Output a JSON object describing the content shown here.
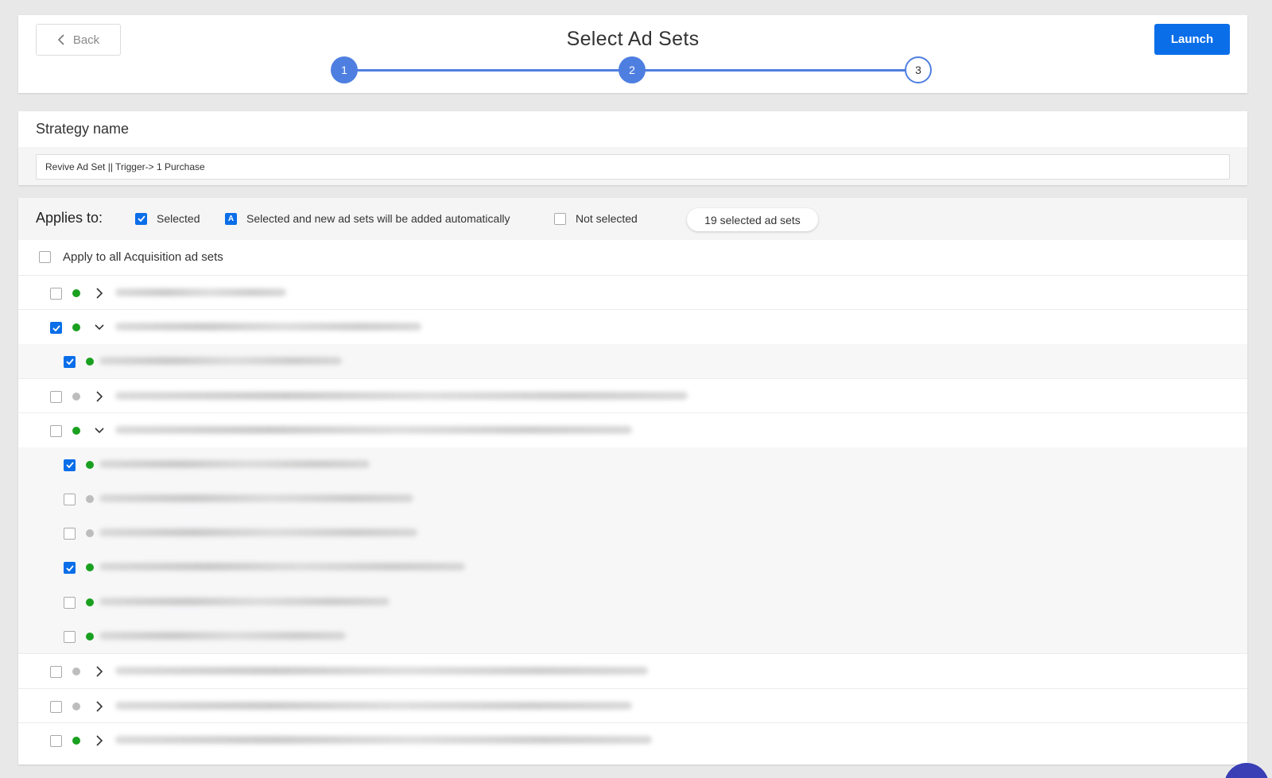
{
  "header": {
    "back_label": "Back",
    "title": "Select Ad Sets",
    "launch_label": "Launch",
    "steps": [
      "1",
      "2",
      "3"
    ]
  },
  "strategy": {
    "label": "Strategy name",
    "value": "Revive Ad Set || Trigger-> 1 Purchase"
  },
  "applies": {
    "title": "Applies to:",
    "legend_selected": "Selected",
    "legend_auto_icon": "A",
    "legend_auto": "Selected and new ad sets will be added automatically",
    "legend_not_selected": "Not selected",
    "count": "19 selected ad sets",
    "apply_all_label": "Apply to all Acquisition ad sets"
  },
  "colors": {
    "accent": "#0a6ee8",
    "step": "#4e7fe0",
    "active_dot": "#1aa020",
    "inactive_dot": "#bdbdbd"
  },
  "rows": [
    {
      "level": 0,
      "checked": false,
      "status": "active",
      "expand": "collapsed"
    },
    {
      "level": 0,
      "checked": true,
      "status": "active",
      "expand": "expanded"
    },
    {
      "level": 1,
      "checked": true,
      "status": "active"
    },
    {
      "level": 0,
      "checked": false,
      "status": "inactive",
      "expand": "collapsed"
    },
    {
      "level": 0,
      "checked": false,
      "status": "active",
      "expand": "expanded"
    },
    {
      "level": 1,
      "checked": true,
      "status": "active"
    },
    {
      "level": 1,
      "checked": false,
      "status": "inactive"
    },
    {
      "level": 1,
      "checked": false,
      "status": "inactive"
    },
    {
      "level": 1,
      "checked": true,
      "status": "active"
    },
    {
      "level": 1,
      "checked": false,
      "status": "active"
    },
    {
      "level": 1,
      "checked": false,
      "status": "active"
    },
    {
      "level": 0,
      "checked": false,
      "status": "inactive",
      "expand": "collapsed"
    },
    {
      "level": 0,
      "checked": false,
      "status": "inactive",
      "expand": "collapsed"
    },
    {
      "level": 0,
      "checked": false,
      "status": "active",
      "expand": "collapsed"
    }
  ]
}
